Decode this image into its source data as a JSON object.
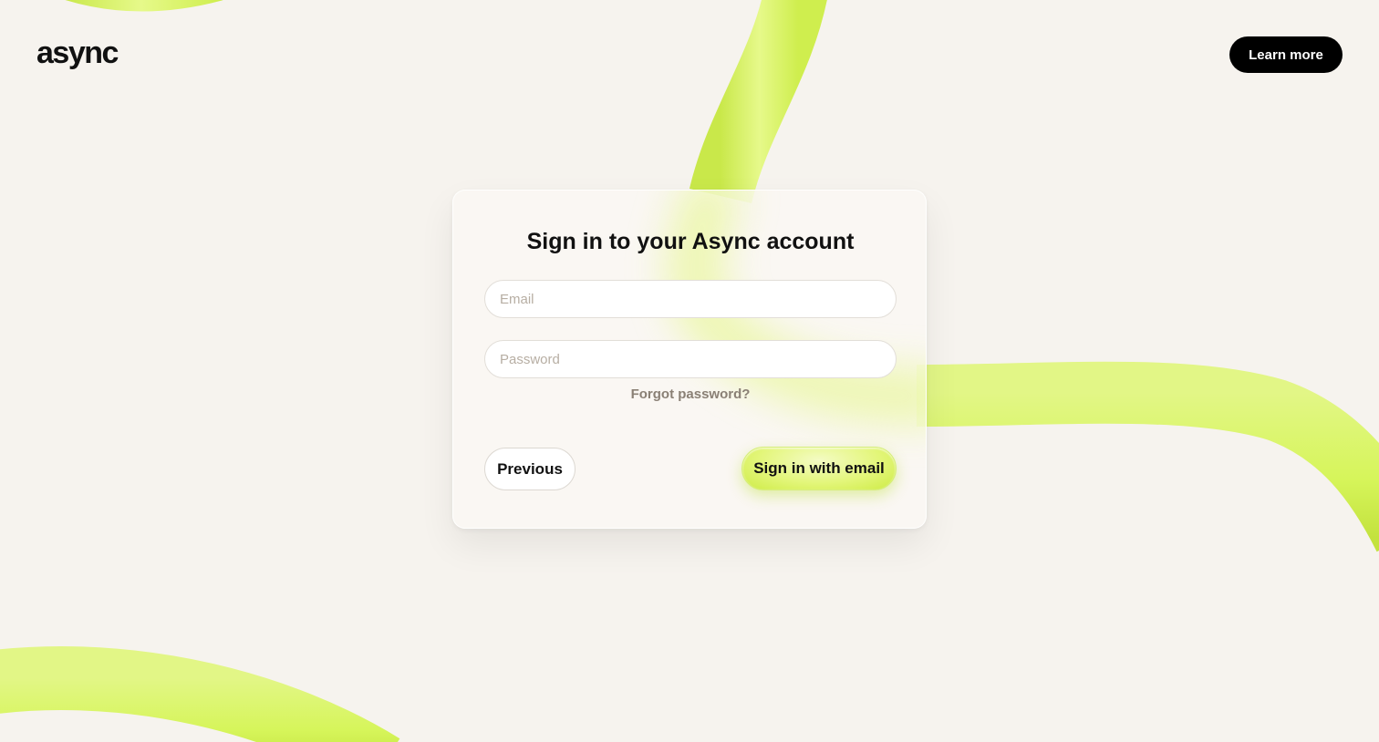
{
  "header": {
    "logo_text": "async",
    "learn_more_label": "Learn more"
  },
  "card": {
    "title": "Sign in to your Async account",
    "email_placeholder": "Email",
    "password_placeholder": "Password",
    "forgot_label": "Forgot password?",
    "previous_label": "Previous",
    "submit_label": "Sign in with email"
  },
  "colors": {
    "background": "#f6f3ee",
    "accent_lime": "#dff66a",
    "primary_dark": "#000000",
    "muted_text": "#8a8075"
  }
}
